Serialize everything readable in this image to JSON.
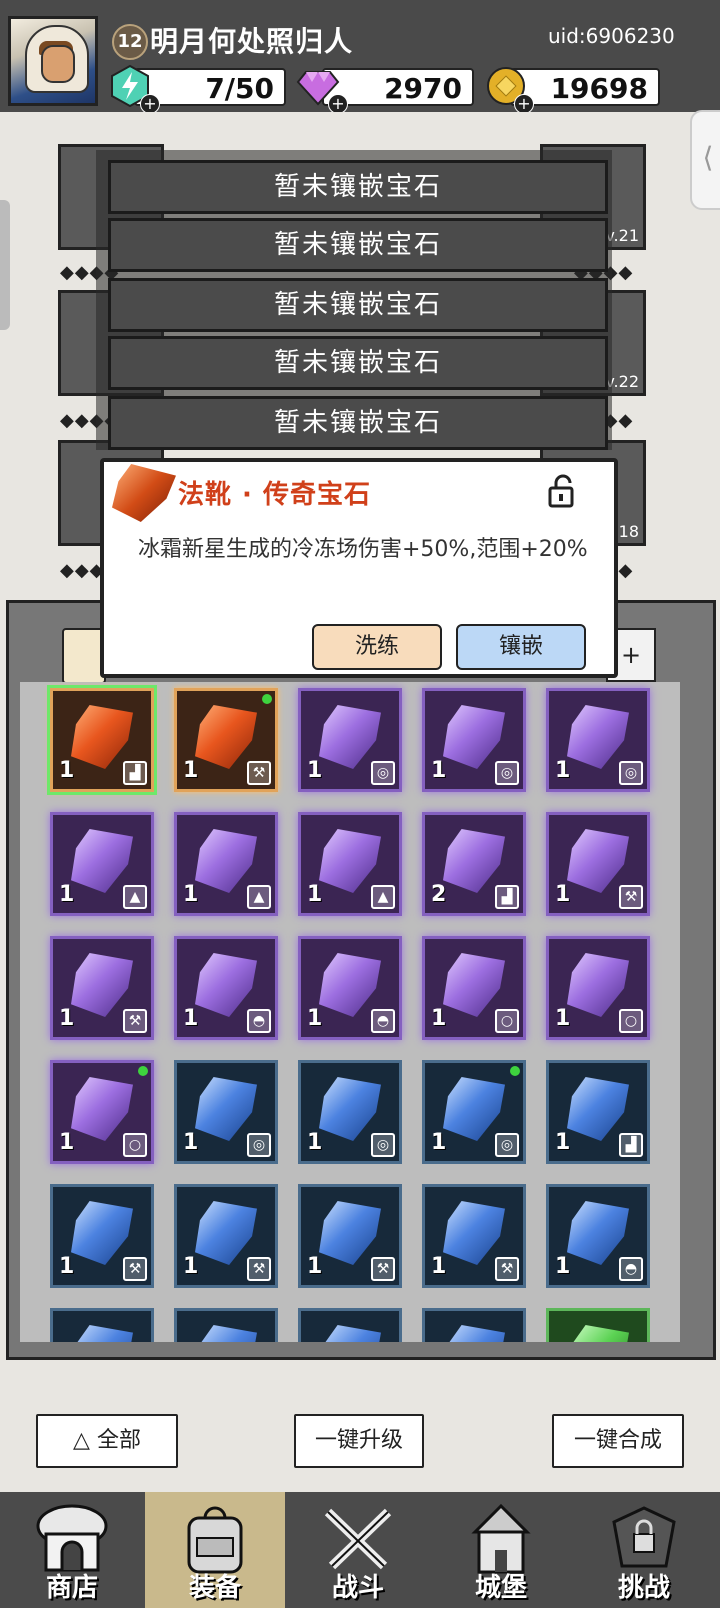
{
  "player": {
    "level": "12",
    "name": "明月何处照归人",
    "uid": "uid:6906230"
  },
  "resources": {
    "energy": "7/50",
    "diamonds": "2970",
    "gold": "19698"
  },
  "equipment_levels": [
    "Lv.21",
    "Lv.22",
    "Lv.18"
  ],
  "gem_slots": [
    "暂未镶嵌宝石",
    "暂未镶嵌宝石",
    "暂未镶嵌宝石",
    "暂未镶嵌宝石",
    "暂未镶嵌宝石"
  ],
  "popup": {
    "title": "法靴 · 传奇宝石",
    "description": "冰霜新星生成的冷冻场伤害+50%,范围+20%",
    "refine_label": "洗练",
    "inlay_label": "镶嵌"
  },
  "inventory": [
    {
      "rarity": "orange",
      "count": "1",
      "slot": "boot",
      "new": false,
      "selected": true
    },
    {
      "rarity": "orange",
      "count": "1",
      "slot": "hammer",
      "new": true,
      "selected": false
    },
    {
      "rarity": "purple",
      "count": "1",
      "slot": "ring",
      "new": false
    },
    {
      "rarity": "purple",
      "count": "1",
      "slot": "ring",
      "new": false
    },
    {
      "rarity": "purple",
      "count": "1",
      "slot": "ring",
      "new": false
    },
    {
      "rarity": "purple",
      "count": "1",
      "slot": "armor",
      "new": false
    },
    {
      "rarity": "purple",
      "count": "1",
      "slot": "armor",
      "new": false
    },
    {
      "rarity": "purple",
      "count": "1",
      "slot": "armor",
      "new": false
    },
    {
      "rarity": "purple",
      "count": "2",
      "slot": "boot",
      "new": false
    },
    {
      "rarity": "purple",
      "count": "1",
      "slot": "hammer",
      "new": false
    },
    {
      "rarity": "purple",
      "count": "1",
      "slot": "hammer",
      "new": false
    },
    {
      "rarity": "purple",
      "count": "1",
      "slot": "helmet",
      "new": false
    },
    {
      "rarity": "purple",
      "count": "1",
      "slot": "helmet",
      "new": false
    },
    {
      "rarity": "purple",
      "count": "1",
      "slot": "necklace",
      "new": false
    },
    {
      "rarity": "purple",
      "count": "1",
      "slot": "necklace",
      "new": false
    },
    {
      "rarity": "purple",
      "count": "1",
      "slot": "necklace",
      "new": true
    },
    {
      "rarity": "blue",
      "count": "1",
      "slot": "ring",
      "new": false
    },
    {
      "rarity": "blue",
      "count": "1",
      "slot": "ring",
      "new": false
    },
    {
      "rarity": "blue",
      "count": "1",
      "slot": "ring",
      "new": true
    },
    {
      "rarity": "blue",
      "count": "1",
      "slot": "boot",
      "new": false
    },
    {
      "rarity": "blue",
      "count": "1",
      "slot": "hammer",
      "new": false
    },
    {
      "rarity": "blue",
      "count": "1",
      "slot": "hammer",
      "new": false
    },
    {
      "rarity": "blue",
      "count": "1",
      "slot": "hammer",
      "new": false
    },
    {
      "rarity": "blue",
      "count": "1",
      "slot": "hammer",
      "new": false
    },
    {
      "rarity": "blue",
      "count": "1",
      "slot": "helmet",
      "new": false
    },
    {
      "rarity": "blue",
      "count": "",
      "slot": "",
      "new": false
    },
    {
      "rarity": "blue",
      "count": "",
      "slot": "",
      "new": false
    },
    {
      "rarity": "blue",
      "count": "",
      "slot": "",
      "new": false
    },
    {
      "rarity": "blue",
      "count": "",
      "slot": "",
      "new": false
    },
    {
      "rarity": "green",
      "count": "",
      "slot": "",
      "new": false
    }
  ],
  "actions": {
    "filter_label": "全部",
    "upgrade_all": "一键升级",
    "merge_all": "一键合成"
  },
  "nav": [
    {
      "label": "商店",
      "icon": "shop-icon"
    },
    {
      "label": "装备",
      "icon": "backpack-icon",
      "active": true
    },
    {
      "label": "战斗",
      "icon": "swords-icon"
    },
    {
      "label": "城堡",
      "icon": "castle-icon"
    },
    {
      "label": "挑战",
      "icon": "challenge-icon"
    }
  ]
}
